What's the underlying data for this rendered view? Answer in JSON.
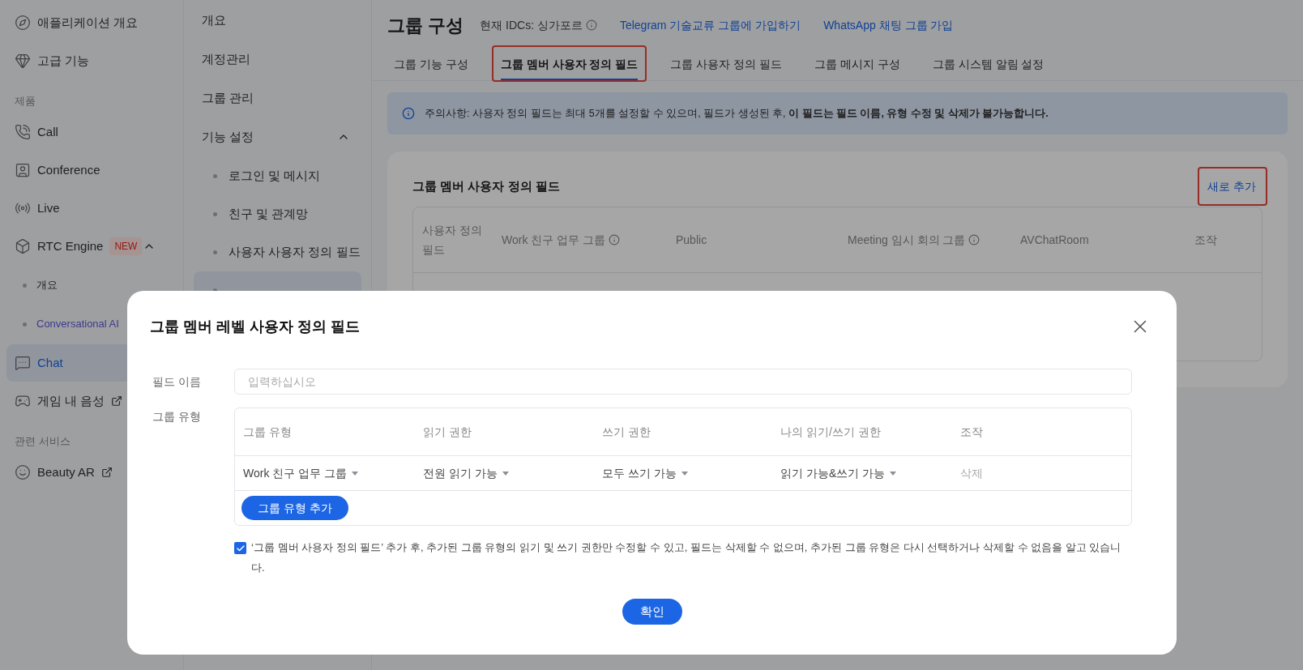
{
  "sidebar": {
    "items": [
      {
        "kind": "item",
        "label": "애플리케이션 개요",
        "selected": false
      },
      {
        "kind": "item",
        "label": "고급 기능",
        "selected": false
      },
      {
        "kind": "section",
        "label": "제품"
      },
      {
        "kind": "item",
        "label": "Call",
        "selected": false
      },
      {
        "kind": "item",
        "label": "Conference",
        "selected": false
      },
      {
        "kind": "item",
        "label": "Live",
        "selected": false
      },
      {
        "kind": "item",
        "label": "RTC Engine",
        "selected": false,
        "badge": "NEW",
        "expanded": true
      },
      {
        "kind": "subitem",
        "label": "개요",
        "accent": false
      },
      {
        "kind": "subitem",
        "label": "Conversational AI",
        "accent": true
      },
      {
        "kind": "item",
        "label": "Chat",
        "selected": true
      },
      {
        "kind": "item",
        "label": "게임 내 음성",
        "selected": false,
        "external": true
      },
      {
        "kind": "section",
        "label": "관련 서비스"
      },
      {
        "kind": "item",
        "label": "Beauty AR",
        "selected": false,
        "external": true
      }
    ]
  },
  "subnav": {
    "items": [
      {
        "label": "개요"
      },
      {
        "label": "계정관리"
      },
      {
        "label": "그룹 관리"
      },
      {
        "label": "기능 설정",
        "expanded": true,
        "children": [
          {
            "label": "로그인 및 메시지",
            "selected": false
          },
          {
            "label": "친구 및 관계망",
            "selected": false
          },
          {
            "label": "사용자 사용자 정의 필드",
            "selected": false
          },
          {
            "selected": true
          }
        ]
      }
    ]
  },
  "header": {
    "title": "그룹 구성",
    "idc": "현재 IDCs: 싱가포르",
    "links": [
      "Telegram 기술교류 그룹에 가입하기",
      "WhatsApp 채팅 그룹 가입"
    ]
  },
  "tabs": [
    {
      "label": "그룹 기능 구성",
      "selected": false,
      "highlighted": false
    },
    {
      "label": "그룹 멤버 사용자 정의 필드",
      "selected": true,
      "highlighted": true
    },
    {
      "label": "그룹 사용자 정의 필드",
      "selected": false,
      "highlighted": false
    },
    {
      "label": "그룹 메시지 구성",
      "selected": false,
      "highlighted": false
    },
    {
      "label": "그룹 시스템 알림 설정",
      "selected": false,
      "highlighted": false
    }
  ],
  "notice": "주의사항: 사용자 정의 필드는 최대 5개를 설정할 수 있으며, 필드가 생성된 후, **이 필드는 필드 이름, 유형 수정 및 삭제가 불가능합니다.**",
  "card": {
    "title": "그룹 멤버 사용자 정의 필드",
    "add_link": {
      "label": "새로 추가",
      "highlighted": true
    },
    "table": {
      "columns": [
        {
          "label": "사용자 정의 필드"
        },
        {
          "label": "Work 친구 업무 그룹",
          "info": true
        },
        {
          "label": "Public"
        },
        {
          "label": "Meeting 임시 회의 그룹",
          "info": true
        },
        {
          "label": "AVChatRoom"
        },
        {
          "label": "조작"
        }
      ]
    }
  },
  "modal": {
    "title": "그룹 멤버 레벨 사용자 정의 필드",
    "field_name": {
      "label": "필드 이름",
      "placeholder": "입력하십시오"
    },
    "group_type": {
      "label": "그룹 유형",
      "columns": [
        "그룹 유형",
        "읽기 권한",
        "쓰기 권한",
        "나의 읽기/쓰기 권한",
        "조작"
      ],
      "rows": [
        {
          "cells": [
            "Work 친구 업무 그룹",
            "전원 읽기 가능",
            "모두 쓰기 가능",
            "읽기 가능&쓰기 가능"
          ],
          "action": "삭제"
        }
      ],
      "add_button": "그룹 유형 추가"
    },
    "agreement": {
      "checked": true,
      "text": "‘그룹 멤버 사용자 정의 필드’ 추가 후, 추가된 그룹 유형의 읽기 및 쓰기 권한만 수정할 수 있고, 필드는 삭제할 수 없으며, 추가된 그룹 유형은 다시 선택하거나 삭제할 수 없음을 알고 있습니다."
    },
    "confirm": "확인"
  }
}
